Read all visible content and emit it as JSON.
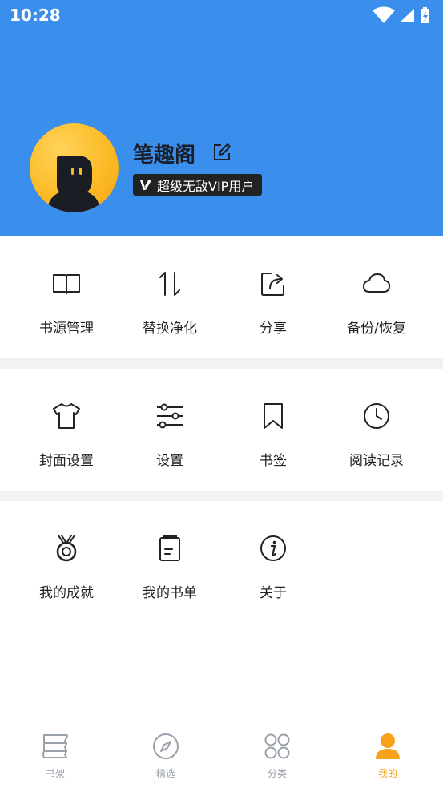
{
  "status_bar": {
    "time": "10:28"
  },
  "profile": {
    "name": "笔趣阁",
    "badge": "超级无敌VIP用户"
  },
  "menu": {
    "row1": [
      {
        "label": "书源管理",
        "icon": "book-open-icon"
      },
      {
        "label": "替换净化",
        "icon": "swap-arrows-icon"
      },
      {
        "label": "分享",
        "icon": "share-icon"
      },
      {
        "label": "备份/恢复",
        "icon": "cloud-icon"
      }
    ],
    "row2": [
      {
        "label": "封面设置",
        "icon": "tshirt-icon"
      },
      {
        "label": "设置",
        "icon": "sliders-icon"
      },
      {
        "label": "书签",
        "icon": "bookmark-icon"
      },
      {
        "label": "阅读记录",
        "icon": "clock-icon"
      }
    ],
    "row3": [
      {
        "label": "我的成就",
        "icon": "medal-icon"
      },
      {
        "label": "我的书单",
        "icon": "booklist-icon"
      },
      {
        "label": "关于",
        "icon": "info-icon"
      }
    ]
  },
  "tabbar": {
    "tabs": [
      {
        "label": "书架",
        "icon": "bookshelf-icon"
      },
      {
        "label": "精选",
        "icon": "compass-icon"
      },
      {
        "label": "分类",
        "icon": "category-icon"
      },
      {
        "label": "我的",
        "icon": "person-icon"
      }
    ],
    "active_index": 3
  },
  "colors": {
    "header_bg": "#3b8fec",
    "accent": "#f7a21b",
    "avatar": "#fbb822",
    "badge_bg": "#222222"
  }
}
